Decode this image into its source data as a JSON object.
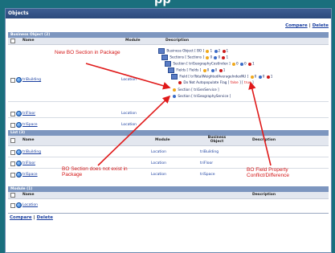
{
  "banner": {
    "text": "pp"
  },
  "panel": {
    "title": "Objects",
    "links": {
      "compare": "Compare",
      "delete": "Delete"
    }
  },
  "business_section": {
    "header": "Business Object (2)",
    "columns": {
      "name": "Name",
      "module": "Module",
      "description": "Description"
    },
    "rows": [
      {
        "name": "triBuilding",
        "module": "Location"
      },
      {
        "name": "triFloor",
        "module": "Location"
      },
      {
        "name": "triSpace",
        "module": "Location"
      }
    ],
    "tree": {
      "line1": "Business Object [ BO ]",
      "line1_counts": [
        "1",
        "2",
        "1"
      ],
      "line2": "Sections [ Sections ]",
      "line2_counts": [
        "0",
        "0",
        "1"
      ],
      "line3": "Section [ triGeographyCostIndex ]",
      "line3_counts": [
        "0",
        "0",
        "1"
      ],
      "line4": "Fields [ Fields ]",
      "line4_counts": [
        "0",
        "0",
        "1"
      ],
      "line5": "Field [ triTotalWeightedAverageIndexNU ]",
      "line5_counts": [
        "0",
        "0",
        "1"
      ],
      "line6_prefix": "Do Not Autopopulate Flag [ ",
      "line6_false": "false",
      "line6_mid": " ] [ ",
      "line6_true": "true",
      "line6_suffix": " ]",
      "line7": "Section [ triGenService ]",
      "line8": "Section [ triGeographyService ]"
    }
  },
  "list_section": {
    "header": "List (3)",
    "columns": {
      "name": "Name",
      "module": "Module",
      "business_object": "Business Object",
      "description": "Description"
    },
    "rows": [
      {
        "name": "triBuilding",
        "module": "Location",
        "bo": "triBuilding"
      },
      {
        "name": "triFloor",
        "module": "Location",
        "bo": "triFloor"
      },
      {
        "name": "triSpace",
        "module": "Location",
        "bo": "triSpace"
      }
    ]
  },
  "module_section": {
    "header": "Module (1)",
    "columns": {
      "name": "Name",
      "description": "Description"
    },
    "rows": [
      {
        "name": "Location"
      }
    ]
  },
  "bottom_links": {
    "compare": "Compare",
    "delete": "Delete"
  },
  "annotations": {
    "new_section": "New BO Section in Package",
    "not_exist": "BO Section does not exist in Package",
    "field_conflict": "BO Field Property Conflict/Difference"
  }
}
